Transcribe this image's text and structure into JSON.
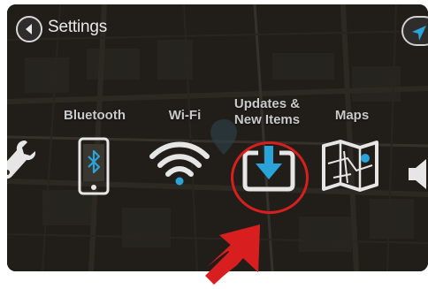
{
  "header": {
    "title": "Settings",
    "back_icon": "chevron-left-icon",
    "nav_icon": "navigation-arrow-icon"
  },
  "menu": {
    "items": [
      {
        "label": "",
        "icon": "wrench-icon"
      },
      {
        "label": "Bluetooth",
        "icon": "bluetooth-phone-icon"
      },
      {
        "label": "Wi-Fi",
        "icon": "wifi-icon"
      },
      {
        "label": "Updates &\nNew Items",
        "icon": "download-icon",
        "selected": true
      },
      {
        "label": "Maps",
        "icon": "map-icon"
      },
      {
        "label": "",
        "icon": "speaker-icon"
      }
    ]
  },
  "colors": {
    "accent": "#2aa3d8",
    "highlight": "#d81e1e",
    "icon": "#e6e6e6",
    "text": "#c9c9c9"
  }
}
